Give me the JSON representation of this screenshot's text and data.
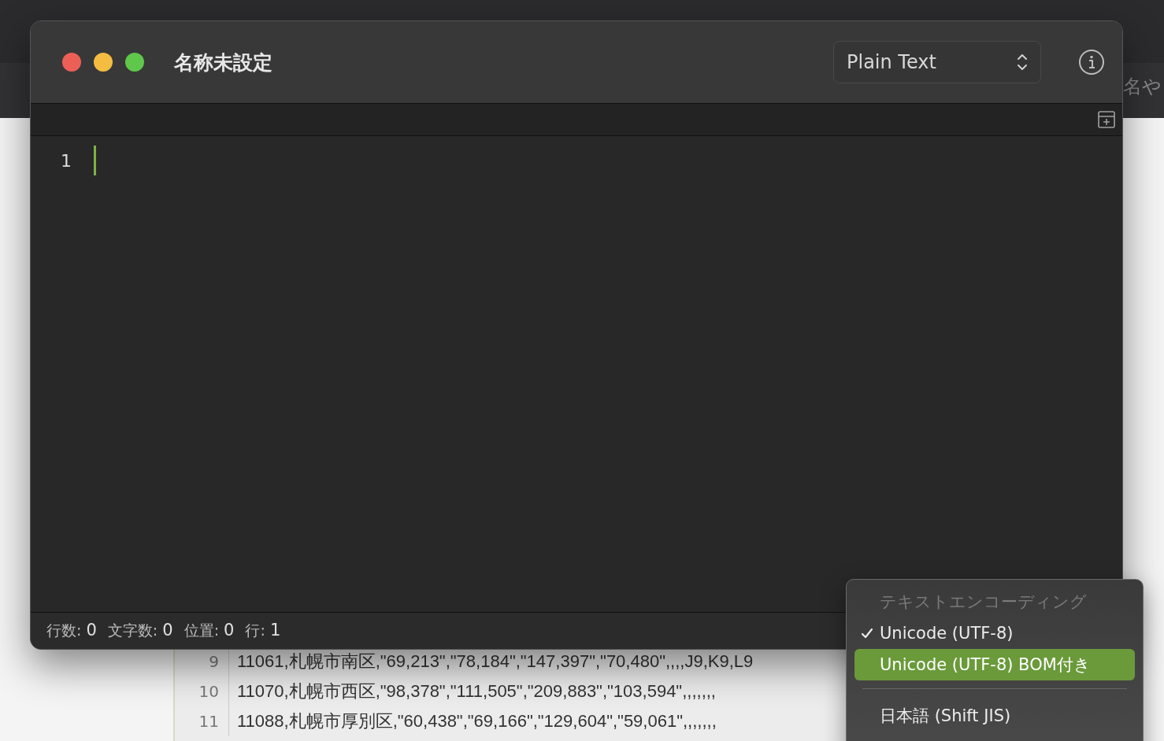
{
  "background_window": {
    "heading_fragment": "名や",
    "rows": [
      {
        "line": "9",
        "text": "11061,札幌市南区,\"69,213\",\"78,184\",\"147,397\",\"70,480\",,,,J9,K9,L9"
      },
      {
        "line": "10",
        "text": "11070,札幌市西区,\"98,378\",\"111,505\",\"209,883\",\"103,594\",,,,,,,"
      },
      {
        "line": "11",
        "text": "11088,札幌市厚別区,\"60,438\",\"69,166\",\"129,604\",\"59,061\",,,,,,,"
      }
    ]
  },
  "window": {
    "title": "名称未設定",
    "syntax_popup": {
      "value": "Plain Text"
    }
  },
  "editor": {
    "line_numbers": [
      "1"
    ]
  },
  "status_bar": [
    {
      "label": "行数:",
      "value": "0"
    },
    {
      "label": "文字数:",
      "value": "0"
    },
    {
      "label": "位置:",
      "value": "0"
    },
    {
      "label": "行:",
      "value": "1"
    }
  ],
  "encoding_menu": {
    "header": "テキストエンコーディング",
    "items": [
      {
        "label": "Unicode (UTF-8)",
        "checked": true,
        "selected": false
      },
      {
        "label": "Unicode (UTF-8) BOM付き",
        "checked": false,
        "selected": true
      },
      {
        "kind": "separator"
      },
      {
        "label": "日本語 (Shift JIS)",
        "checked": false,
        "selected": false
      }
    ]
  }
}
